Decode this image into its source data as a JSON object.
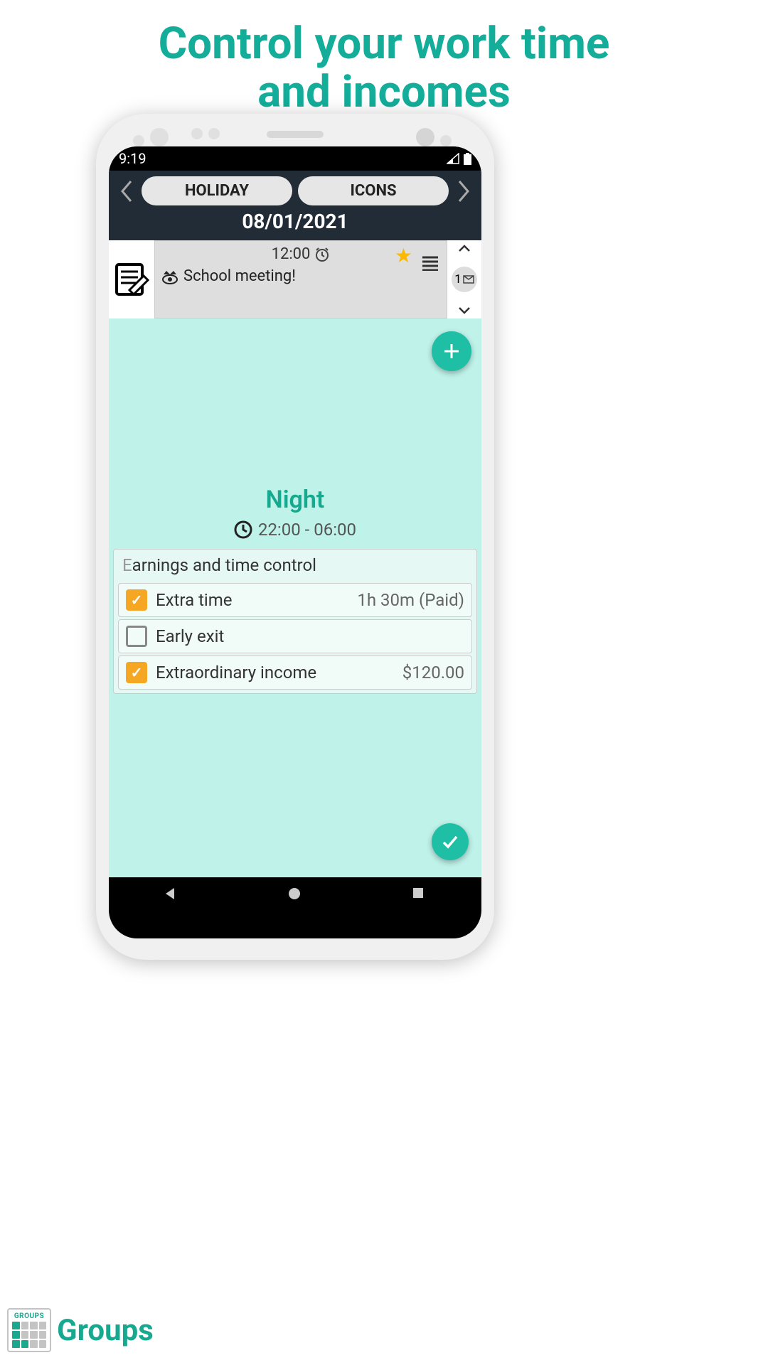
{
  "promo": {
    "title_line1": "Control your work time",
    "title_line2": "and incomes"
  },
  "status_bar": {
    "time": "9:19"
  },
  "header": {
    "holiday_btn": "HOLIDAY",
    "icons_btn": "ICONS",
    "date": "08/01/2021"
  },
  "note": {
    "time": "12:00",
    "text": "School meeting!",
    "badge": "1"
  },
  "shift": {
    "name": "Night",
    "time_range": "22:00 - 06:00"
  },
  "earnings": {
    "title_first": "E",
    "title_rest": "arnings and time control",
    "rows": [
      {
        "label": "Extra time",
        "value": "1h 30m (Paid)",
        "checked": true
      },
      {
        "label": "Early exit",
        "value": "",
        "checked": false
      },
      {
        "label": "Extraordinary income",
        "value": "$120.00",
        "checked": true
      }
    ]
  },
  "footer": {
    "logo_label": "GROUPS",
    "brand": "Groups"
  }
}
